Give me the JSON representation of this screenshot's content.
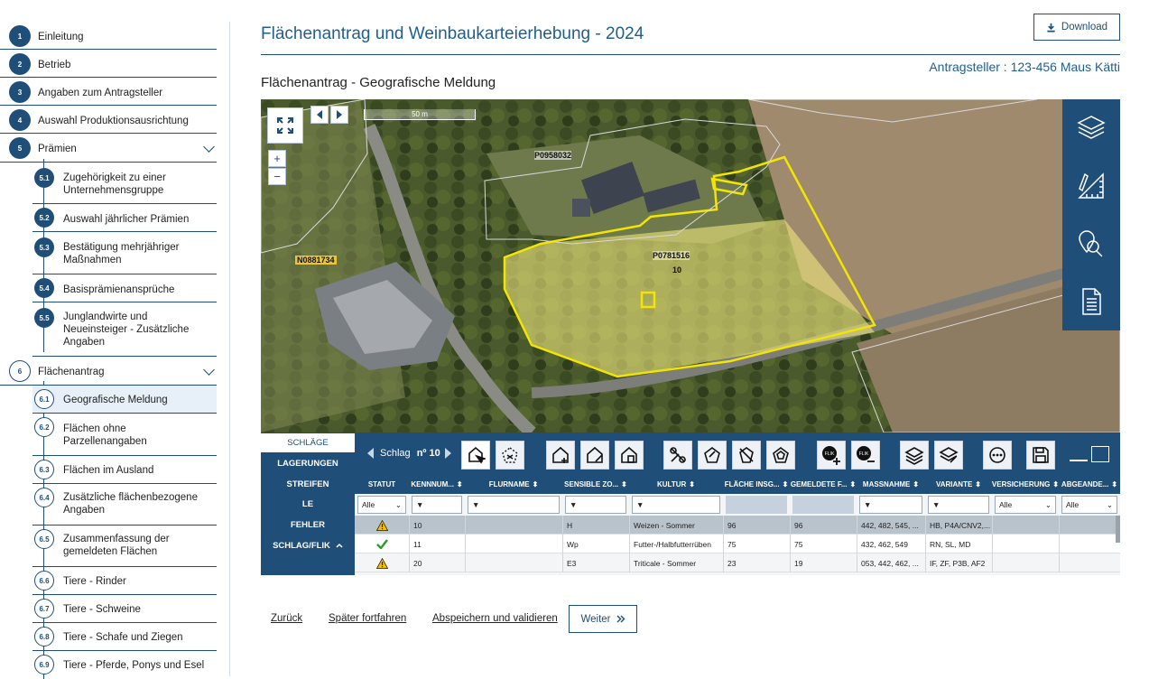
{
  "sidebar": {
    "steps": [
      {
        "num": "1",
        "label": "Einleitung"
      },
      {
        "num": "2",
        "label": "Betrieb"
      },
      {
        "num": "3",
        "label": "Angaben zum Antragsteller"
      },
      {
        "num": "4",
        "label": "Auswahl Produktionsausrichtung"
      },
      {
        "num": "5",
        "label": "Prämien"
      },
      {
        "num": "6",
        "label": "Flächenantrag"
      }
    ],
    "substeps5": [
      {
        "num": "5.1",
        "label": "Zugehörigkeit zu einer Unternehmensgruppe"
      },
      {
        "num": "5.2",
        "label": "Auswahl jährlicher Prämien"
      },
      {
        "num": "5.3",
        "label": "Bestätigung mehrjähriger Maßnahmen"
      },
      {
        "num": "5.4",
        "label": "Basisprämienansprüche"
      },
      {
        "num": "5.5",
        "label": "Junglandwirte und Neueinsteiger - Zusätzliche Angaben"
      }
    ],
    "substeps6": [
      {
        "num": "6.1",
        "label": "Geografische Meldung"
      },
      {
        "num": "6.2",
        "label": "Flächen ohne Parzellenangaben"
      },
      {
        "num": "6.3",
        "label": "Flächen im Ausland"
      },
      {
        "num": "6.4",
        "label": "Zusätzliche flächenbezogene Angaben"
      },
      {
        "num": "6.5",
        "label": "Zusammenfassung der gemeldeten Flächen"
      },
      {
        "num": "6.6",
        "label": "Tiere - Rinder"
      },
      {
        "num": "6.7",
        "label": "Tiere - Schweine"
      },
      {
        "num": "6.8",
        "label": "Tiere - Schafe und Ziegen"
      },
      {
        "num": "6.9",
        "label": "Tiere - Pferde, Ponys und Esel"
      }
    ]
  },
  "header": {
    "title": "Flächenantrag und Weinbaukarteierhebung - 2024",
    "download_label": "Download",
    "applicant": "Antragsteller : 123-456 Maus Kätti",
    "subtitle": "Flächenantrag - Geografische Meldung"
  },
  "map": {
    "scale_label": "50 m",
    "parcel_main": "P0781516",
    "parcel_main_num": "10",
    "parcel_top": "P0958032",
    "parcel_left": "N0881734",
    "zoom_in": "+",
    "zoom_out": "−"
  },
  "tabs": [
    "SCHLÄGE",
    "LAGERUNGEN",
    "STREIFEN",
    "LE",
    "FEHLER",
    "SCHLAG/FLIK"
  ],
  "toolbar": {
    "schlag_label": "Schlag",
    "schlag_no": "nº 10",
    "flik": "FLIK"
  },
  "table": {
    "headers": [
      "STATUT",
      "KENNNUM...",
      "FLURNAME",
      "SENSIBLE ZO...",
      "KULTUR",
      "FLÄCHE INSG...",
      "GEMELDETE F...",
      "MASSNAHME",
      "VARIANTE",
      "VERSICHERUNG",
      "ABGEANDE..."
    ],
    "filter_all": "Alle",
    "rows": [
      {
        "status": "warn",
        "kenn": "10",
        "flur": "",
        "sens": "H",
        "kultur": "Weizen - Sommer",
        "flaeche": "96",
        "gemeldet": "96",
        "massnahme": "442, 482, 545, ...",
        "variante": "HB, P4A/CNV2,...",
        "vers": "",
        "abg": ""
      },
      {
        "status": "ok",
        "kenn": "11",
        "flur": "",
        "sens": "Wp",
        "kultur": "Futter-/Halbfutterrüben",
        "flaeche": "75",
        "gemeldet": "75",
        "massnahme": "432, 462, 549",
        "variante": "RN, SL, MD",
        "vers": "",
        "abg": ""
      },
      {
        "status": "warn",
        "kenn": "20",
        "flur": "",
        "sens": "E3",
        "kultur": "Triticale - Sommer",
        "flaeche": "23",
        "gemeldet": "19",
        "massnahme": "053, 442, 462, ...",
        "variante": "IF, ZF, P3B, AF2",
        "vers": "",
        "abg": ""
      }
    ]
  },
  "footer": {
    "back": "Zurück",
    "later": "Später fortfahren",
    "save": "Abspeichern und validieren",
    "next": "Weiter"
  },
  "colors": {
    "primary": "#1f4e79",
    "accent": "#1f5f8f",
    "parcel": "#f2e600"
  }
}
